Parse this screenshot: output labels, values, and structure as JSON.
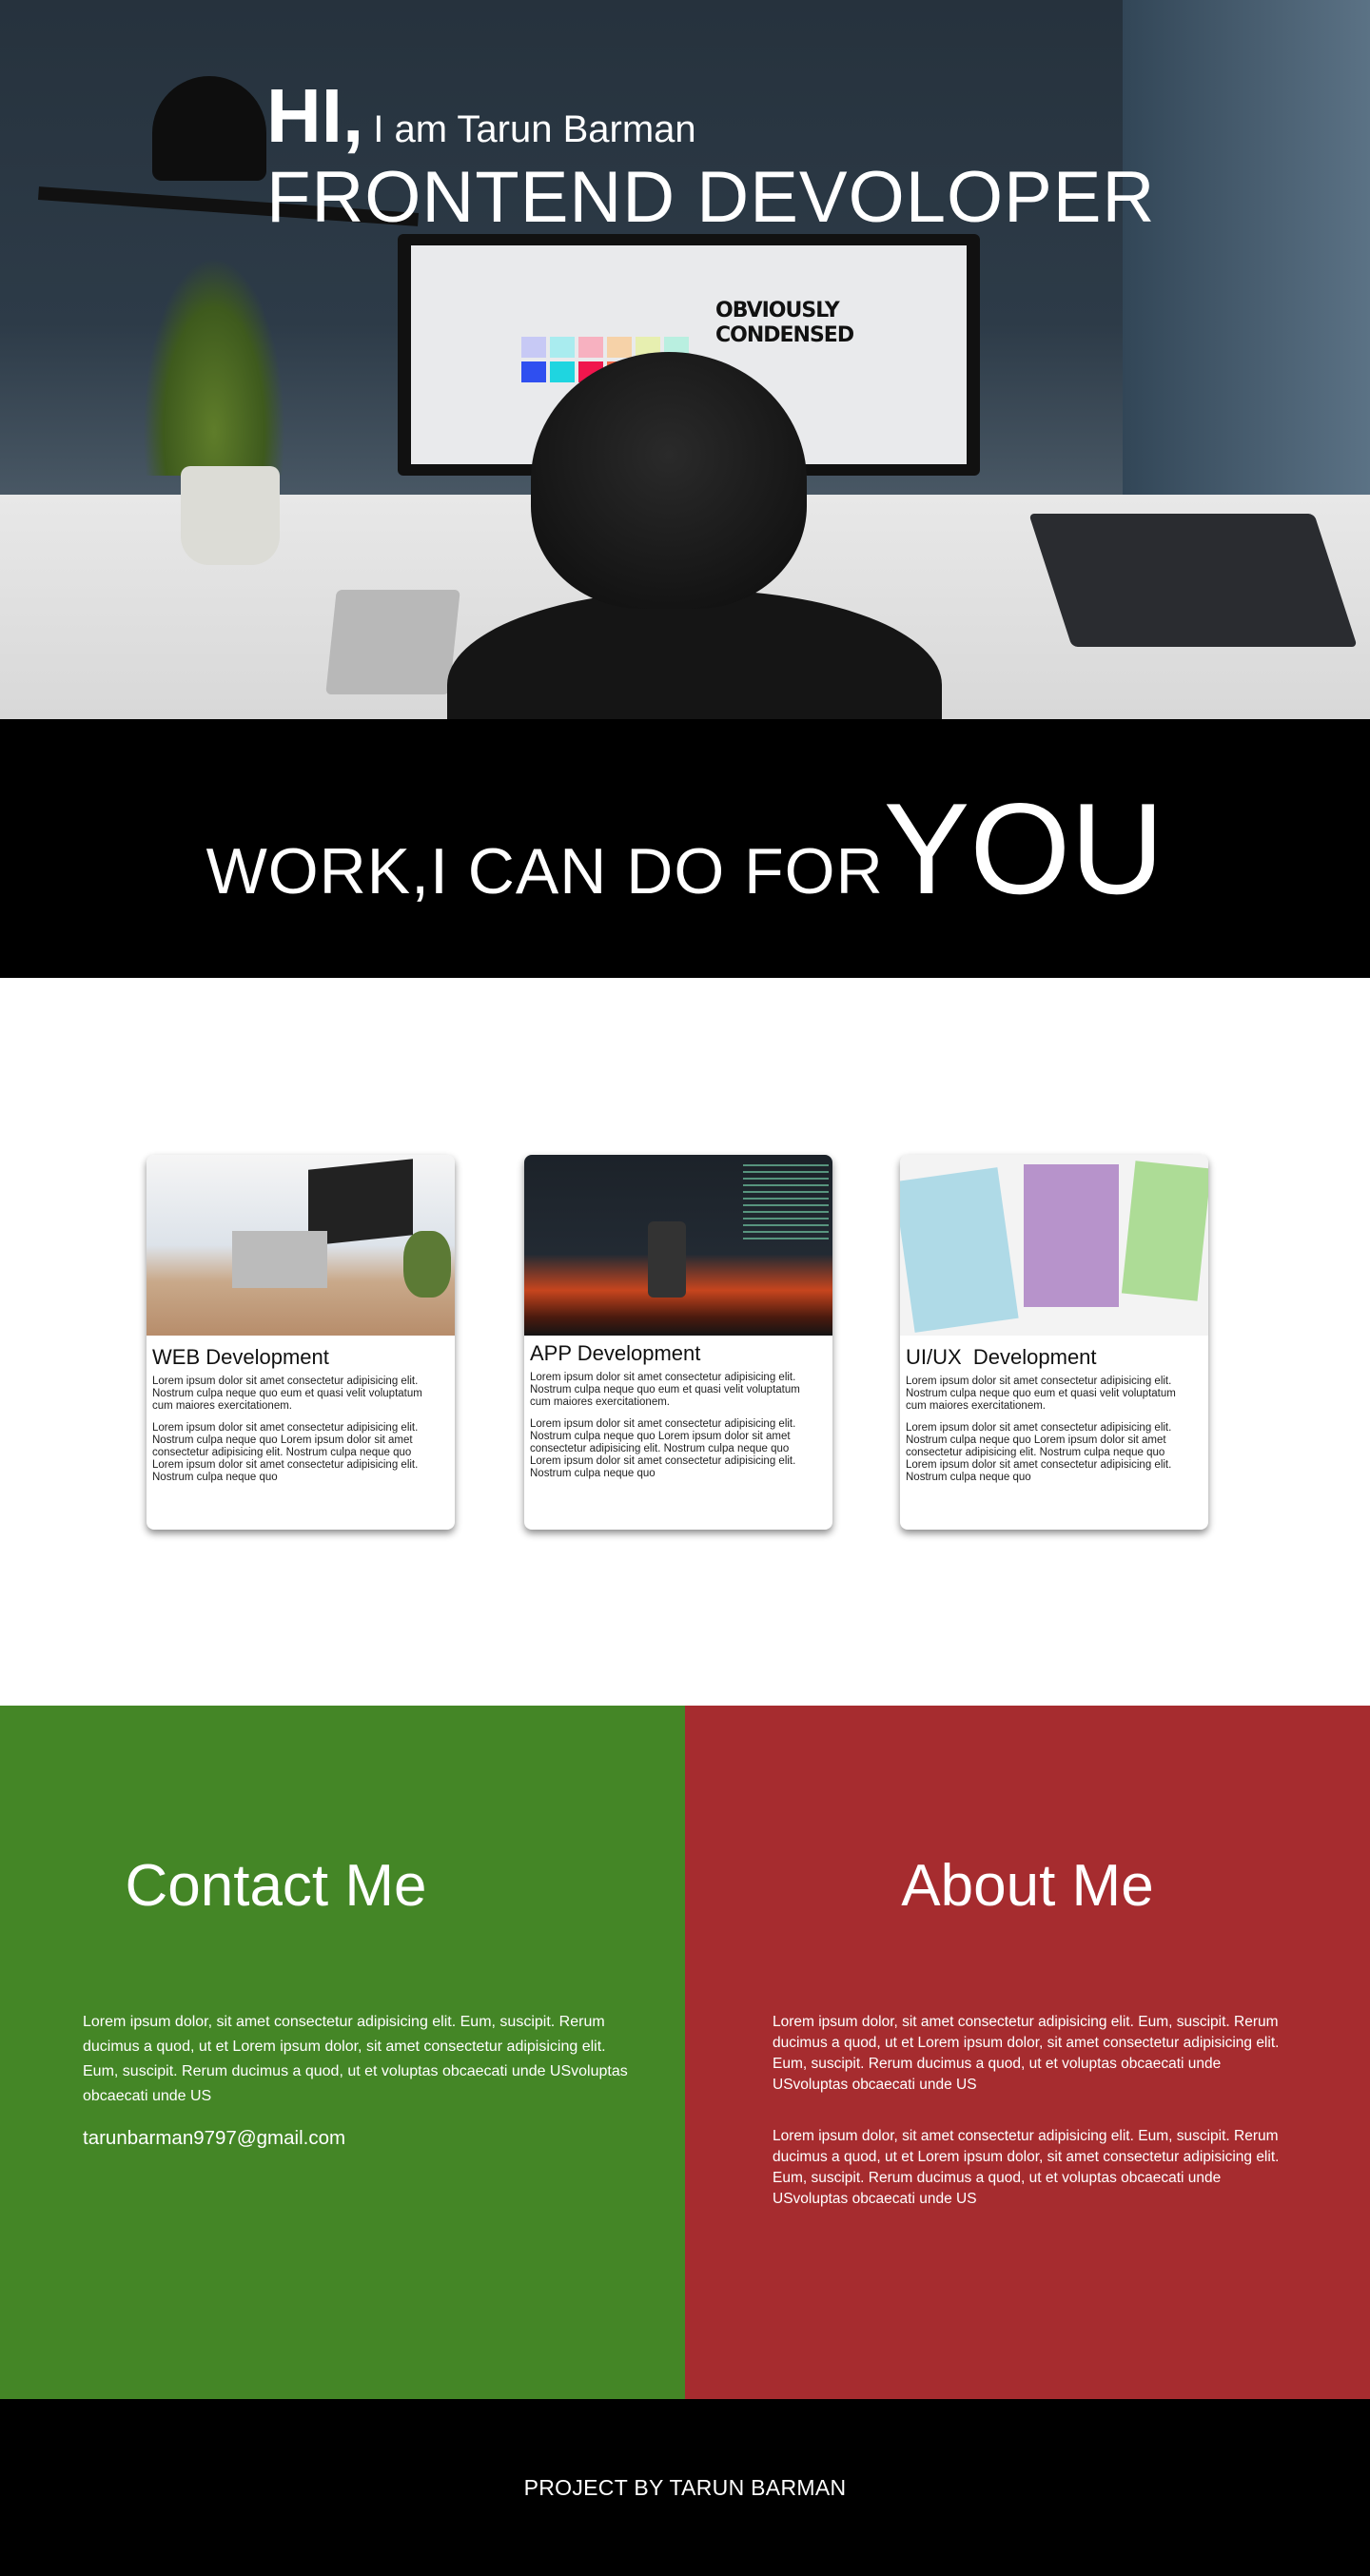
{
  "hero": {
    "greeting": "HI,",
    "intro": "I am Tarun Barman",
    "role": "FRONTEND DEVOLOPER",
    "screen_title": "OBVIOUSLY CONDENSED"
  },
  "banner": {
    "text_small": "WORK,I CAN DO FOR",
    "text_big": "YOU"
  },
  "services": [
    {
      "title": "WEB Development",
      "p1": "Lorem ipsum dolor sit amet consectetur adipisicing elit. Nostrum culpa neque quo eum et quasi velit voluptatum cum maiores exercitationem.",
      "p2": "Lorem ipsum dolor sit amet consectetur adipisicing elit. Nostrum culpa neque quo Lorem ipsum dolor sit amet consectetur adipisicing elit. Nostrum culpa neque quo Lorem ipsum dolor sit amet consectetur adipisicing elit. Nostrum culpa neque quo"
    },
    {
      "title": "APP Development",
      "p1": "Lorem ipsum dolor sit amet consectetur adipisicing elit. Nostrum culpa neque quo eum et quasi velit voluptatum cum maiores exercitationem.",
      "p2": "Lorem ipsum dolor sit amet consectetur adipisicing elit. Nostrum culpa neque quo Lorem ipsum dolor sit amet consectetur adipisicing elit. Nostrum culpa neque quo Lorem ipsum dolor sit amet consectetur adipisicing elit. Nostrum culpa neque quo"
    },
    {
      "title": "UI/UX  Development",
      "p1": "Lorem ipsum dolor sit amet consectetur adipisicing elit. Nostrum culpa neque quo eum et quasi velit voluptatum cum maiores exercitationem.",
      "p2": "Lorem ipsum dolor sit amet consectetur adipisicing elit. Nostrum culpa neque quo Lorem ipsum dolor sit amet consectetur adipisicing elit. Nostrum culpa neque quo Lorem ipsum dolor sit amet consectetur adipisicing elit. Nostrum culpa neque quo"
    }
  ],
  "contact": {
    "title": "Contact Me",
    "text": "Lorem ipsum dolor, sit amet consectetur adipisicing elit. Eum, suscipit. Rerum ducimus a quod, ut et Lorem ipsum dolor, sit amet consectetur adipisicing elit. Eum, suscipit. Rerum ducimus a quod, ut et voluptas obcaecati unde USvoluptas obcaecati unde US",
    "email": "tarunbarman9797@gmail.com",
    "bg_color": "#448626"
  },
  "about": {
    "title": "About Me",
    "text1": "Lorem ipsum dolor, sit amet consectetur adipisicing elit. Eum, suscipit. Rerum ducimus a quod, ut et Lorem ipsum dolor, sit amet consectetur adipisicing elit. Eum, suscipit. Rerum ducimus a quod, ut et voluptas obcaecati unde USvoluptas obcaecati unde US",
    "text2": "Lorem ipsum dolor, sit amet consectetur adipisicing elit. Eum, suscipit. Rerum ducimus a quod, ut et Lorem ipsum dolor, sit amet consectetur adipisicing elit. Eum, suscipit. Rerum ducimus a quod, ut et voluptas obcaecati unde USvoluptas obcaecati unde US",
    "bg_color": "#a62c2f"
  },
  "footer": {
    "text": "PROJECT BY TARUN BARMAN"
  }
}
